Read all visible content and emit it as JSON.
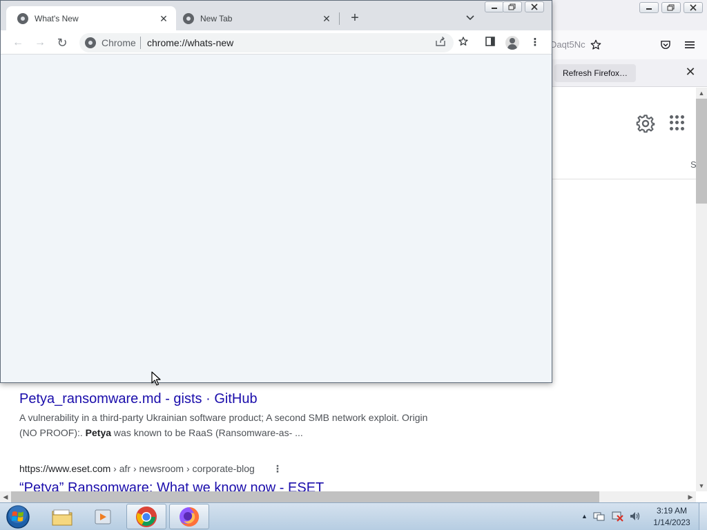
{
  "firefox": {
    "url_fragment": "Daqt5Nc",
    "refresh_button_label": "Refresh Firefox…",
    "close_glyph": "✕",
    "google_s_fragment": "S",
    "results": [
      {
        "title_fragment": "Petya_ransomware.md - gists · GitHub",
        "snippet_line1": "A vulnerability in a third-party Ukrainian software product; A second SMB network exploit. Origin",
        "snippet_line2_prefix": "(NO PROOF):. ",
        "snippet_bold": "Petya",
        "snippet_line2_suffix": " was known to be RaaS (Ransomware-as- ..."
      },
      {
        "url_host": "https://www.eset.com",
        "url_path": " › afr › newsroom › corporate-blog",
        "kebab": "⋮",
        "title": "“Petya” Ransomware: What we know now - ESET"
      }
    ]
  },
  "chrome": {
    "tabs": [
      {
        "label": "What's New",
        "close": "✕"
      },
      {
        "label": "New Tab",
        "close": "✕"
      }
    ],
    "new_tab_glyph": "+",
    "tab_search_glyph": "⌄",
    "window_buttons": {
      "minimize": "▭",
      "maximize": "⧉",
      "close": "✕"
    },
    "omnibox": {
      "scheme_label": "Chrome",
      "url": "chrome://whats-new"
    },
    "nav": {
      "back": "←",
      "forward": "→",
      "reload": "↻"
    },
    "toolbar_icons": {
      "share": "⇪",
      "bookmark": "☆",
      "side_panel": "◧",
      "menu": "⋮"
    }
  },
  "taskbar": {
    "clock_time": "3:19 AM",
    "clock_date": "1/14/2023",
    "tray_arrow": "▲"
  }
}
